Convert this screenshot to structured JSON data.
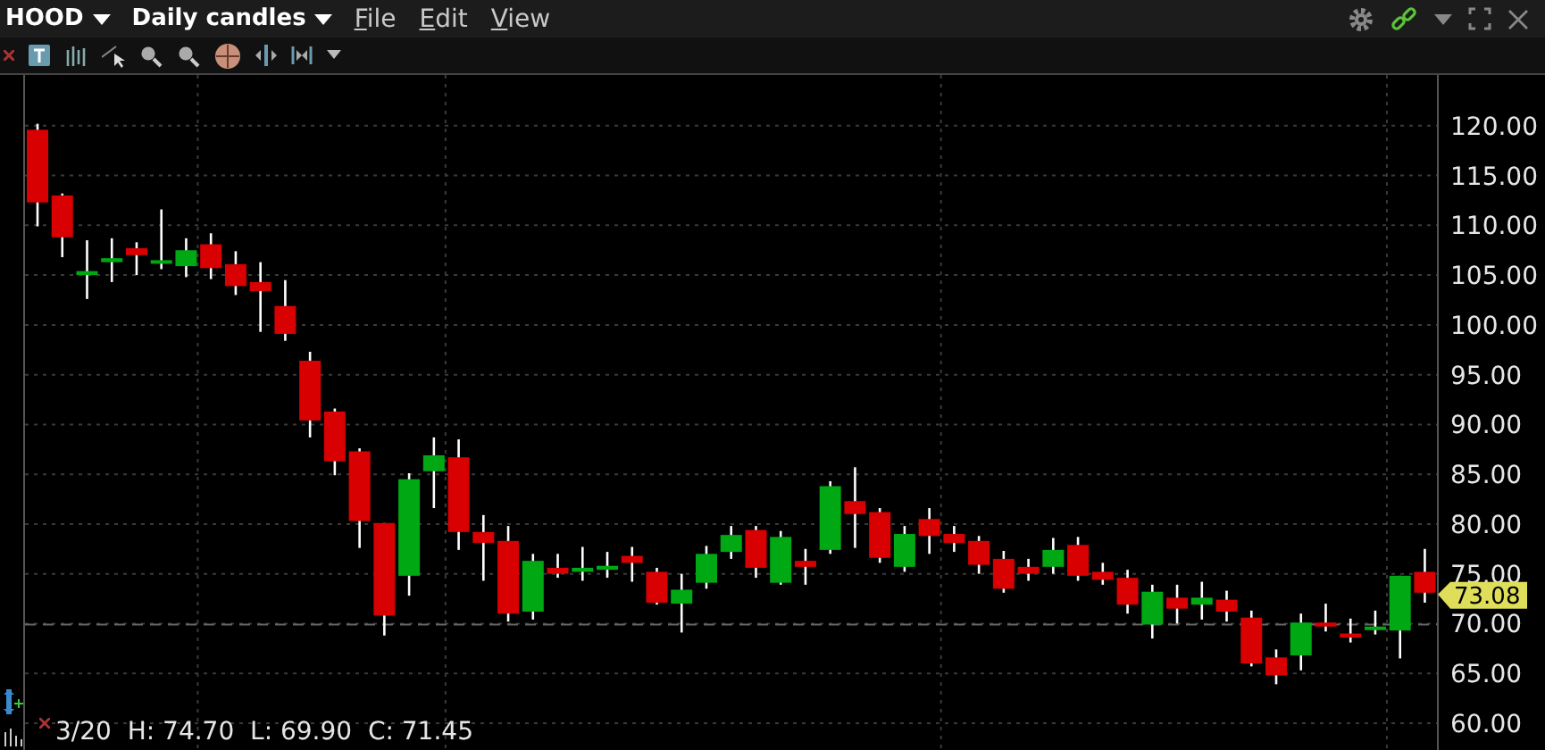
{
  "header": {
    "symbol": "HOOD",
    "timeframe": "Daily candles",
    "menus": [
      {
        "label": "File"
      },
      {
        "label": "Edit"
      },
      {
        "label": "View"
      }
    ]
  },
  "chart": {
    "chart_data": {
      "type": "candlestick",
      "ylim": [
        57.3,
        125.1
      ],
      "grid": true,
      "yticks": [
        {
          "value": 60,
          "label": "60.00"
        },
        {
          "value": 65,
          "label": "65.00"
        },
        {
          "value": 70,
          "label": "70.00"
        },
        {
          "value": 75,
          "label": "75.00"
        },
        {
          "value": 80,
          "label": "80.00"
        },
        {
          "value": 85,
          "label": "85.00"
        },
        {
          "value": 90,
          "label": "90.00"
        },
        {
          "value": 95,
          "label": "95.00"
        },
        {
          "value": 100,
          "label": "100.00"
        },
        {
          "value": 105,
          "label": "105.00"
        },
        {
          "value": 110,
          "label": "110.00"
        },
        {
          "value": 115,
          "label": "115.00"
        },
        {
          "value": 120,
          "label": "120.00"
        }
      ],
      "ohlc": [
        [
          119.6,
          120.2,
          109.9,
          112.3
        ],
        [
          113.0,
          113.2,
          106.8,
          108.8
        ],
        [
          105.0,
          108.5,
          102.6,
          105.4
        ],
        [
          106.3,
          108.7,
          104.3,
          106.7
        ],
        [
          107.7,
          108.3,
          105.0,
          107.0
        ],
        [
          106.3,
          111.6,
          105.6,
          106.5
        ],
        [
          105.9,
          108.7,
          104.8,
          107.5
        ],
        [
          108.1,
          109.2,
          104.6,
          105.7
        ],
        [
          106.1,
          107.4,
          103.0,
          103.9
        ],
        [
          104.3,
          106.3,
          99.3,
          103.4
        ],
        [
          101.9,
          104.5,
          98.4,
          99.1
        ],
        [
          96.4,
          97.3,
          88.7,
          90.4
        ],
        [
          91.3,
          91.6,
          84.9,
          86.3
        ],
        [
          87.3,
          87.6,
          77.6,
          80.3
        ],
        [
          80.1,
          80.1,
          68.8,
          70.8
        ],
        [
          74.8,
          85.1,
          72.8,
          84.5
        ],
        [
          85.3,
          88.7,
          81.6,
          86.9
        ],
        [
          86.7,
          88.5,
          77.4,
          79.2
        ],
        [
          79.2,
          80.9,
          74.3,
          78.1
        ],
        [
          78.3,
          79.8,
          70.2,
          71.0
        ],
        [
          71.2,
          77.0,
          70.4,
          76.3
        ],
        [
          75.6,
          77.0,
          74.6,
          75.0
        ],
        [
          75.2,
          77.7,
          74.3,
          75.6
        ],
        [
          75.4,
          77.2,
          74.6,
          75.8
        ],
        [
          76.8,
          77.7,
          74.2,
          76.1
        ],
        [
          75.2,
          75.6,
          71.9,
          72.1
        ],
        [
          72.0,
          75.0,
          69.1,
          73.4
        ],
        [
          74.1,
          77.8,
          73.5,
          77.0
        ],
        [
          77.2,
          79.8,
          76.5,
          78.9
        ],
        [
          79.4,
          79.8,
          74.6,
          75.6
        ],
        [
          74.1,
          79.3,
          73.9,
          78.7
        ],
        [
          76.3,
          77.5,
          73.9,
          75.7
        ],
        [
          77.4,
          84.3,
          77.0,
          83.8
        ],
        [
          82.3,
          85.7,
          77.6,
          81.0
        ],
        [
          81.2,
          81.6,
          76.1,
          76.6
        ],
        [
          75.7,
          79.8,
          75.2,
          79.0
        ],
        [
          80.5,
          81.6,
          77.0,
          78.8
        ],
        [
          79.0,
          79.8,
          77.2,
          78.1
        ],
        [
          78.3,
          78.8,
          75.0,
          75.9
        ],
        [
          76.5,
          77.3,
          73.1,
          73.5
        ],
        [
          75.7,
          76.5,
          74.3,
          75.0
        ],
        [
          75.7,
          78.6,
          75.0,
          77.4
        ],
        [
          77.9,
          78.7,
          74.3,
          74.8
        ],
        [
          75.2,
          76.1,
          73.9,
          74.4
        ],
        [
          74.6,
          75.4,
          71.0,
          71.9
        ],
        [
          69.9,
          73.9,
          68.5,
          73.2
        ],
        [
          72.6,
          73.9,
          70.0,
          71.5
        ],
        [
          71.9,
          74.2,
          70.4,
          72.6
        ],
        [
          72.4,
          73.3,
          70.2,
          71.2
        ],
        [
          70.6,
          71.3,
          65.7,
          66.0
        ],
        [
          66.6,
          67.4,
          63.9,
          64.8
        ],
        [
          66.8,
          71.0,
          65.3,
          70.1
        ],
        [
          70.1,
          72.0,
          69.2,
          69.7
        ],
        [
          69.0,
          70.5,
          68.1,
          68.6
        ],
        [
          69.5,
          71.3,
          68.9,
          69.7
        ],
        [
          69.3,
          74.8,
          66.5,
          74.8
        ],
        [
          75.2,
          77.5,
          72.1,
          73.1
        ]
      ],
      "ref_lines": [
        {
          "axis": "y",
          "value": 69.9
        }
      ]
    },
    "last_price": "73.08",
    "legend": "3/20  H: 74.70  L: 69.90  C: 71.45"
  }
}
